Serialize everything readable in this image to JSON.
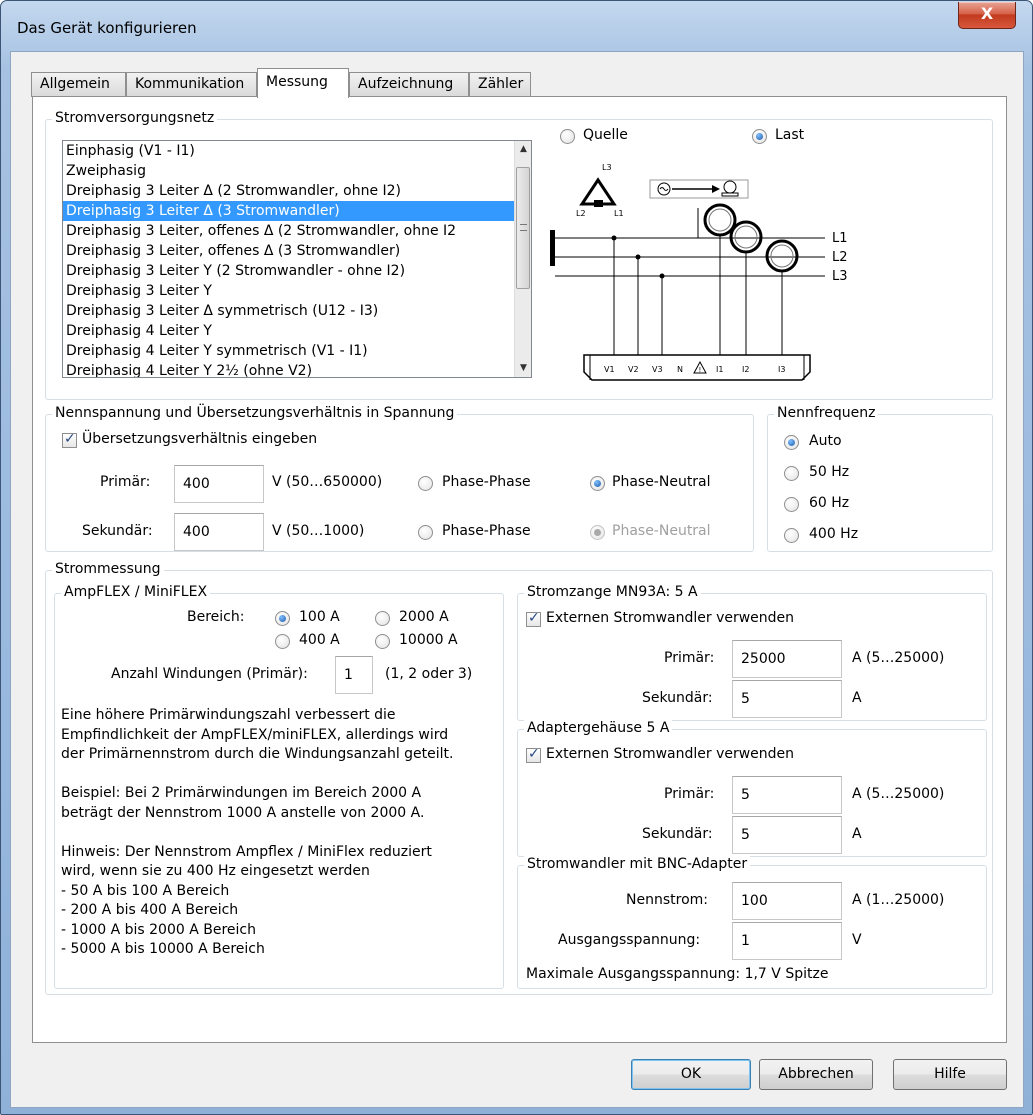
{
  "window": {
    "title": "Das Gerät konfigurieren",
    "close_label": "X"
  },
  "tabs": [
    "Allgemein",
    "Kommunikation",
    "Messung",
    "Aufzeichnung",
    "Zähler"
  ],
  "network": {
    "legend": "Stromversorgungsnetz",
    "items": [
      "Einphasig (V1 - I1)",
      "Zweiphasig",
      "Dreiphasig 3 Leiter Δ  (2 Stromwandler, ohne I2)",
      "Dreiphasig 3 Leiter Δ (3 Stromwandler)",
      "Dreiphasig 3 Leiter, offenes  Δ (2 Stromwandler, ohne I2",
      "Dreiphasig 3 Leiter, offenes  Δ (3 Stromwandler)",
      "Dreiphasig 3 Leiter Y (2 Stromwandler - ohne I2)",
      "Dreiphasig 3 Leiter Y",
      "Dreiphasig 3 Leiter Δ symmetrisch (U12 - I3)",
      "Dreiphasig 4 Leiter Y",
      "Dreiphasig 4 Leiter Y symmetrisch (V1 - I1)",
      "Dreiphasig 4 Leiter Y 2½ (ohne V2)"
    ],
    "selected_index": 3,
    "source_label": "Quelle",
    "load_label": "Last",
    "diagram": {
      "lines": [
        "L1",
        "L2",
        "L3"
      ],
      "delta_labels": [
        "L3",
        "L2",
        "L1"
      ],
      "terminals": [
        "V1",
        "V2",
        "V3",
        "N",
        "I1",
        "I2",
        "I3"
      ]
    }
  },
  "voltage": {
    "legend": "Nennspannung und Übersetzungsverhältnis in Spannung",
    "ratio_label": "Übersetzungsverhältnis eingeben",
    "ratio_checked": true,
    "primary_label": "Primär:",
    "primary_value": "400",
    "primary_range": "V (50…650000)",
    "secondary_label": "Sekundär:",
    "secondary_value": "400",
    "secondary_range": "V (50…1000)",
    "phase_phase": "Phase-Phase",
    "phase_neutral": "Phase-Neutral"
  },
  "frequency": {
    "legend": "Nennfrequenz",
    "options": [
      "Auto",
      "50 Hz",
      "60 Hz",
      "400 Hz"
    ],
    "selected": "Auto"
  },
  "current": {
    "legend": "Strommessung",
    "ampflex": {
      "legend": "AmpFLEX / MiniFLEX",
      "range_label": "Bereich:",
      "range_options": [
        "100 A",
        "2000 A",
        "400 A",
        "10000 A"
      ],
      "range_selected": "100 A",
      "windings_label": "Anzahl Windungen (Primär):",
      "windings_value": "1",
      "windings_hint": "(1, 2 oder 3)",
      "text_lines": [
        "Eine höhere Primärwindungszahl verbessert die",
        "Empfindlichkeit der AmpFLEX/miniFLEX, allerdings wird",
        "der Primärnennstrom durch die Windungsanzahl geteilt.",
        "",
        "Beispiel: Bei 2 Primärwindungen im Bereich 2000 A",
        "beträgt der Nennstrom 1000 A anstelle von 2000 A.",
        "",
        "Hinweis: Der Nennstrom Ampflex / MiniFlex reduziert",
        "wird, wenn sie zu 400 Hz eingesetzt werden",
        "- 50 A bis 100 A Bereich",
        "- 200 A bis 400 A Bereich",
        "- 1000 A bis 2000 A Bereich",
        "- 5000 A bis 10000 A Bereich"
      ]
    },
    "mn93a": {
      "legend": "Stromzange MN93A: 5 A",
      "ext_label": "Externen Stromwandler verwenden",
      "ext_checked": true,
      "primary_label": "Primär:",
      "primary_value": "25000",
      "primary_range": "A (5…25000)",
      "secondary_label": "Sekundär:",
      "secondary_value": "5",
      "secondary_unit": "A"
    },
    "adapter": {
      "legend": "Adaptergehäuse 5 A",
      "ext_label": "Externen Stromwandler verwenden",
      "ext_checked": true,
      "primary_label": "Primär:",
      "primary_value": "5",
      "primary_range": "A (5…25000)",
      "secondary_label": "Sekundär:",
      "secondary_value": "5",
      "secondary_unit": "A"
    },
    "bnc": {
      "legend": "Stromwandler mit  BNC-Adapter",
      "nominal_label": "Nennstrom:",
      "nominal_value": "100",
      "nominal_range": "A (1…25000)",
      "output_label": "Ausgangsspannung:",
      "output_value": "1",
      "output_unit": "V",
      "max_output": "Maximale Ausgangsspannung: 1,7 V Spitze"
    }
  },
  "buttons": {
    "ok": "OK",
    "cancel": "Abbrechen",
    "help": "Hilfe"
  }
}
